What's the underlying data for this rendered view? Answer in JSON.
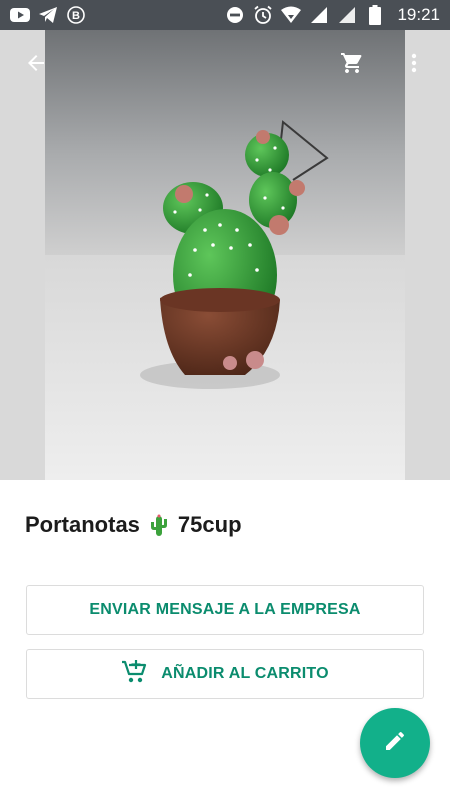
{
  "status_bar": {
    "time": "19:21",
    "left_icons": [
      "youtube-icon",
      "telegram-icon",
      "b-circle-icon"
    ],
    "right_icons": [
      "do-not-disturb-icon",
      "alarm-icon",
      "wifi-icon",
      "signal-icon",
      "signal-icon",
      "battery-icon"
    ]
  },
  "toolbar": {
    "back_icon": "arrow-left-icon",
    "cart_icon": "cart-icon",
    "menu_icon": "more-vert-icon"
  },
  "product": {
    "name": "Portanotas",
    "price": "75cup"
  },
  "buttons": {
    "message_label": "ENVIAR MENSAJE A LA EMPRESA",
    "add_cart_label": "AÑADIR AL CARRITO"
  },
  "fab": {
    "icon": "edit-icon"
  },
  "colors": {
    "accent": "#0b8c6e",
    "fab": "#12b08a",
    "status_bar": "#4a4f55"
  }
}
